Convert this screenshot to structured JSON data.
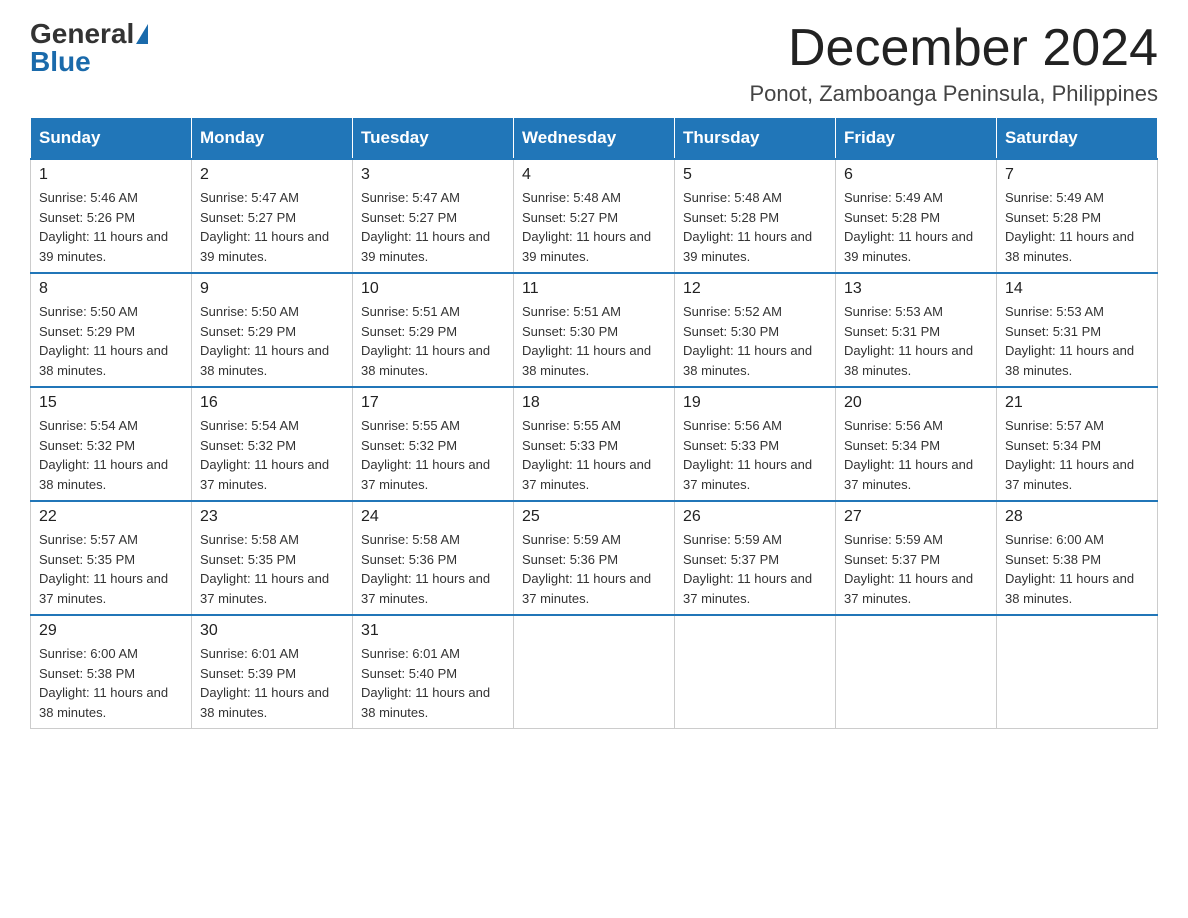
{
  "header": {
    "logo_general": "General",
    "logo_blue": "Blue",
    "month_title": "December 2024",
    "location": "Ponot, Zamboanga Peninsula, Philippines"
  },
  "weekdays": [
    "Sunday",
    "Monday",
    "Tuesday",
    "Wednesday",
    "Thursday",
    "Friday",
    "Saturday"
  ],
  "weeks": [
    [
      {
        "day": "1",
        "sunrise": "5:46 AM",
        "sunset": "5:26 PM",
        "daylight": "11 hours and 39 minutes."
      },
      {
        "day": "2",
        "sunrise": "5:47 AM",
        "sunset": "5:27 PM",
        "daylight": "11 hours and 39 minutes."
      },
      {
        "day": "3",
        "sunrise": "5:47 AM",
        "sunset": "5:27 PM",
        "daylight": "11 hours and 39 minutes."
      },
      {
        "day": "4",
        "sunrise": "5:48 AM",
        "sunset": "5:27 PM",
        "daylight": "11 hours and 39 minutes."
      },
      {
        "day": "5",
        "sunrise": "5:48 AM",
        "sunset": "5:28 PM",
        "daylight": "11 hours and 39 minutes."
      },
      {
        "day": "6",
        "sunrise": "5:49 AM",
        "sunset": "5:28 PM",
        "daylight": "11 hours and 39 minutes."
      },
      {
        "day": "7",
        "sunrise": "5:49 AM",
        "sunset": "5:28 PM",
        "daylight": "11 hours and 38 minutes."
      }
    ],
    [
      {
        "day": "8",
        "sunrise": "5:50 AM",
        "sunset": "5:29 PM",
        "daylight": "11 hours and 38 minutes."
      },
      {
        "day": "9",
        "sunrise": "5:50 AM",
        "sunset": "5:29 PM",
        "daylight": "11 hours and 38 minutes."
      },
      {
        "day": "10",
        "sunrise": "5:51 AM",
        "sunset": "5:29 PM",
        "daylight": "11 hours and 38 minutes."
      },
      {
        "day": "11",
        "sunrise": "5:51 AM",
        "sunset": "5:30 PM",
        "daylight": "11 hours and 38 minutes."
      },
      {
        "day": "12",
        "sunrise": "5:52 AM",
        "sunset": "5:30 PM",
        "daylight": "11 hours and 38 minutes."
      },
      {
        "day": "13",
        "sunrise": "5:53 AM",
        "sunset": "5:31 PM",
        "daylight": "11 hours and 38 minutes."
      },
      {
        "day": "14",
        "sunrise": "5:53 AM",
        "sunset": "5:31 PM",
        "daylight": "11 hours and 38 minutes."
      }
    ],
    [
      {
        "day": "15",
        "sunrise": "5:54 AM",
        "sunset": "5:32 PM",
        "daylight": "11 hours and 38 minutes."
      },
      {
        "day": "16",
        "sunrise": "5:54 AM",
        "sunset": "5:32 PM",
        "daylight": "11 hours and 37 minutes."
      },
      {
        "day": "17",
        "sunrise": "5:55 AM",
        "sunset": "5:32 PM",
        "daylight": "11 hours and 37 minutes."
      },
      {
        "day": "18",
        "sunrise": "5:55 AM",
        "sunset": "5:33 PM",
        "daylight": "11 hours and 37 minutes."
      },
      {
        "day": "19",
        "sunrise": "5:56 AM",
        "sunset": "5:33 PM",
        "daylight": "11 hours and 37 minutes."
      },
      {
        "day": "20",
        "sunrise": "5:56 AM",
        "sunset": "5:34 PM",
        "daylight": "11 hours and 37 minutes."
      },
      {
        "day": "21",
        "sunrise": "5:57 AM",
        "sunset": "5:34 PM",
        "daylight": "11 hours and 37 minutes."
      }
    ],
    [
      {
        "day": "22",
        "sunrise": "5:57 AM",
        "sunset": "5:35 PM",
        "daylight": "11 hours and 37 minutes."
      },
      {
        "day": "23",
        "sunrise": "5:58 AM",
        "sunset": "5:35 PM",
        "daylight": "11 hours and 37 minutes."
      },
      {
        "day": "24",
        "sunrise": "5:58 AM",
        "sunset": "5:36 PM",
        "daylight": "11 hours and 37 minutes."
      },
      {
        "day": "25",
        "sunrise": "5:59 AM",
        "sunset": "5:36 PM",
        "daylight": "11 hours and 37 minutes."
      },
      {
        "day": "26",
        "sunrise": "5:59 AM",
        "sunset": "5:37 PM",
        "daylight": "11 hours and 37 minutes."
      },
      {
        "day": "27",
        "sunrise": "5:59 AM",
        "sunset": "5:37 PM",
        "daylight": "11 hours and 37 minutes."
      },
      {
        "day": "28",
        "sunrise": "6:00 AM",
        "sunset": "5:38 PM",
        "daylight": "11 hours and 38 minutes."
      }
    ],
    [
      {
        "day": "29",
        "sunrise": "6:00 AM",
        "sunset": "5:38 PM",
        "daylight": "11 hours and 38 minutes."
      },
      {
        "day": "30",
        "sunrise": "6:01 AM",
        "sunset": "5:39 PM",
        "daylight": "11 hours and 38 minutes."
      },
      {
        "day": "31",
        "sunrise": "6:01 AM",
        "sunset": "5:40 PM",
        "daylight": "11 hours and 38 minutes."
      },
      null,
      null,
      null,
      null
    ]
  ],
  "labels": {
    "sunrise_prefix": "Sunrise: ",
    "sunset_prefix": "Sunset: ",
    "daylight_prefix": "Daylight: "
  }
}
